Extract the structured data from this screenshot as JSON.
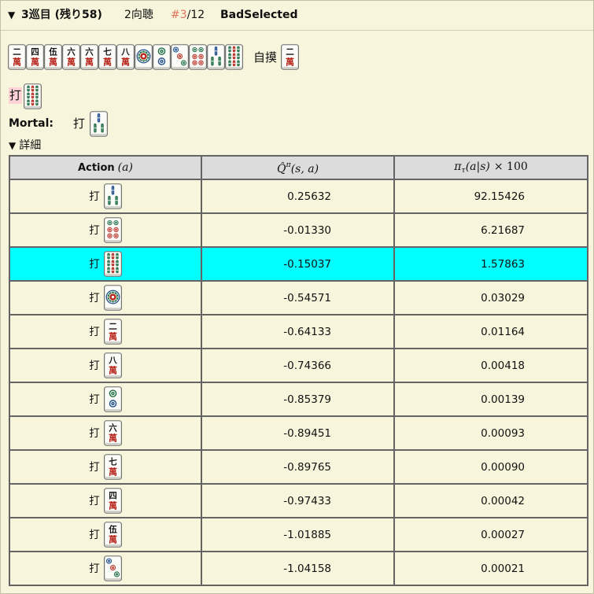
{
  "colors": {
    "background": "#f7f6dc",
    "index_accent": "#e2735d",
    "player_discard_highlight": "#ffd3d6",
    "selected_row_highlight": "#00ffff",
    "table_header_background": "#dcdcdc",
    "table_border": "#646464",
    "tile_red": "#b8281f",
    "tile_green": "#1f6f45",
    "tile_blue": "#22508e"
  },
  "tile_text": {
    "man_suit": "萬",
    "man_numerals": {
      "2": "二",
      "4": "四",
      "5": "伍",
      "6": "六",
      "7": "七",
      "8": "八"
    }
  },
  "labels": {
    "discard": "打",
    "draw": "自摸"
  },
  "header": {
    "toggle": "▼",
    "title": "3巡目 (残り58)",
    "shanten": "2向聴",
    "index": "#3",
    "total": "/12",
    "tag": "BadSelected"
  },
  "hand": {
    "tiles": [
      "man-2-tile-icon",
      "man-4-tile-icon",
      "man-5-tile-icon",
      "man-6-tile-icon",
      "man-6-tile-icon",
      "man-7-tile-icon",
      "man-8-tile-icon",
      "pin-1-tile-icon",
      "pin-2-tile-icon",
      "pin-3-tile-icon",
      "pin-6-tile-icon",
      "sou-3-tile-icon",
      "sou-9-tile-icon"
    ],
    "draw_tile": "man-2-tile-icon"
  },
  "player_action": {
    "tile": "sou-9-tile-icon"
  },
  "mortal_action": {
    "name": "Mortal:",
    "tile": "sou-3-tile-icon"
  },
  "details": {
    "toggle": "▼",
    "label": "詳細",
    "columns": {
      "action": {
        "label": "Action",
        "var": "(a)"
      },
      "q": {
        "main": "Q̂",
        "sup": "π",
        "args": "(s, a)"
      },
      "pi": {
        "main": "π",
        "sub": "τ",
        "args": "(a|s)",
        "tail": "× 100"
      }
    },
    "rows": [
      {
        "tile": "sou-3-tile-icon",
        "q": "0.25632",
        "pi": "92.15426",
        "selected": false
      },
      {
        "tile": "pin-6-tile-icon",
        "q": "-0.01330",
        "pi": "6.21687",
        "selected": false
      },
      {
        "tile": "sou-9-tile-icon",
        "q": "-0.15037",
        "pi": "1.57863",
        "selected": true
      },
      {
        "tile": "pin-1-tile-icon",
        "q": "-0.54571",
        "pi": "0.03029",
        "selected": false
      },
      {
        "tile": "man-2-tile-icon",
        "q": "-0.64133",
        "pi": "0.01164",
        "selected": false
      },
      {
        "tile": "man-8-tile-icon",
        "q": "-0.74366",
        "pi": "0.00418",
        "selected": false
      },
      {
        "tile": "pin-2-tile-icon",
        "q": "-0.85379",
        "pi": "0.00139",
        "selected": false
      },
      {
        "tile": "man-6-tile-icon",
        "q": "-0.89451",
        "pi": "0.00093",
        "selected": false
      },
      {
        "tile": "man-7-tile-icon",
        "q": "-0.89765",
        "pi": "0.00090",
        "selected": false
      },
      {
        "tile": "man-4-tile-icon",
        "q": "-0.97433",
        "pi": "0.00042",
        "selected": false
      },
      {
        "tile": "man-5-tile-icon",
        "q": "-1.01885",
        "pi": "0.00027",
        "selected": false
      },
      {
        "tile": "pin-3-tile-icon",
        "q": "-1.04158",
        "pi": "0.00021",
        "selected": false
      }
    ]
  }
}
